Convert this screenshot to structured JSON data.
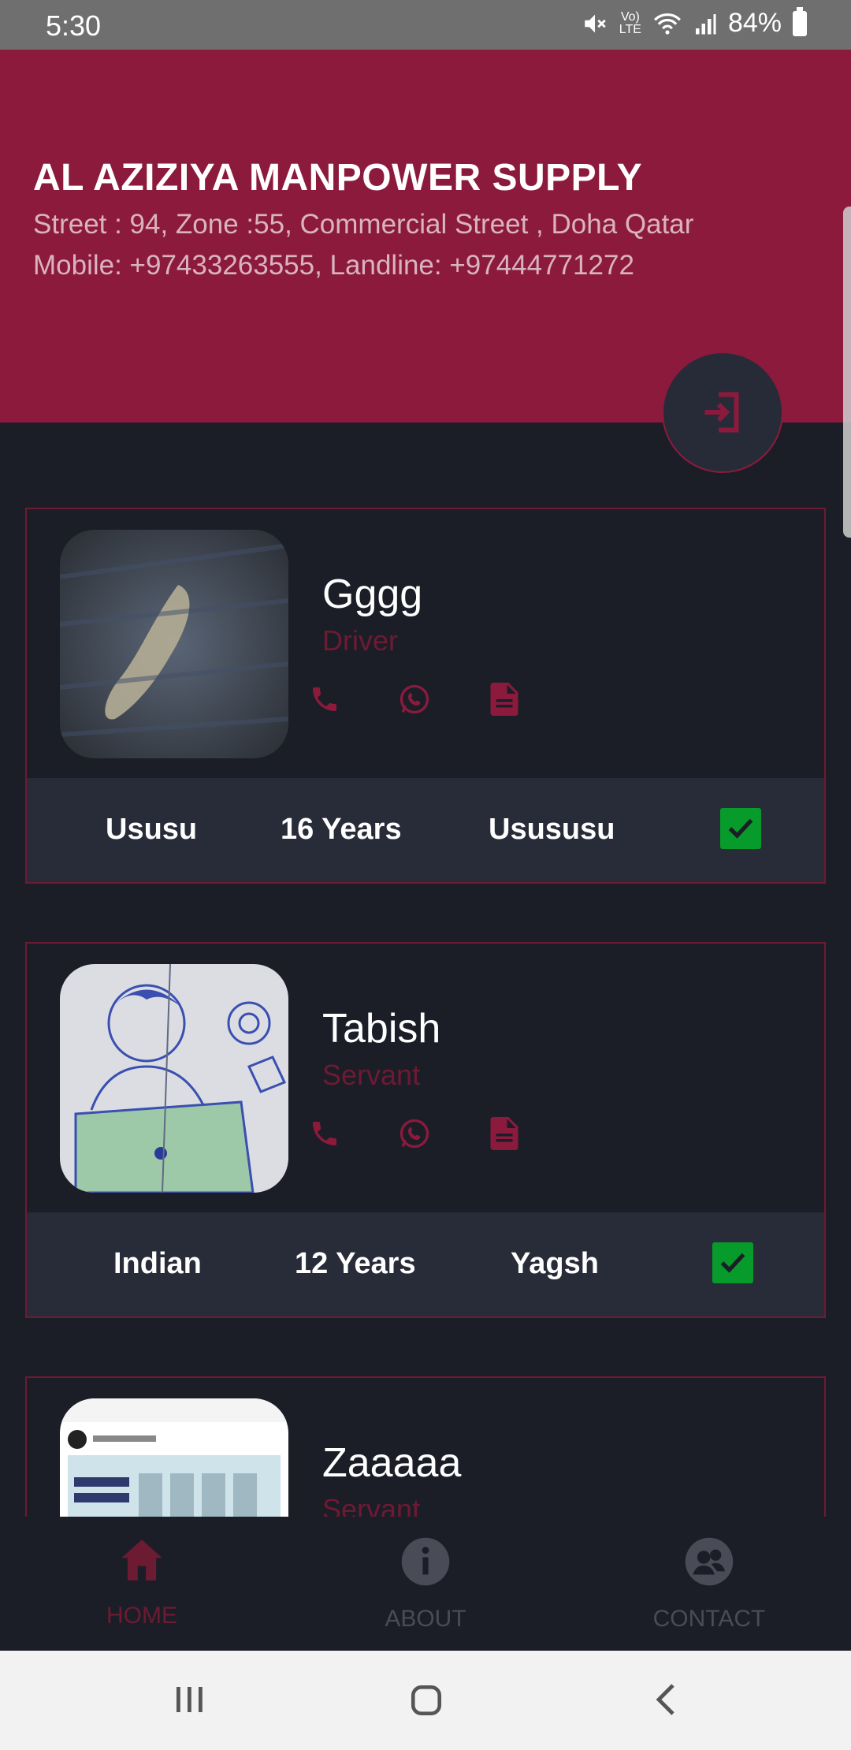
{
  "status_bar": {
    "time": "5:30",
    "battery": "84%",
    "icons": [
      "mute-icon",
      "volte-icon",
      "wifi-icon",
      "signal-icon",
      "battery-icon"
    ]
  },
  "header": {
    "company": "AL AZIZIYA MANPOWER SUPPLY",
    "address": "Street : 94, Zone :55, Commercial Street , Doha Qatar",
    "phones": "Mobile: +97433263555, Landline: +97444771272"
  },
  "fab": {
    "icon": "login-icon"
  },
  "workers": [
    {
      "name": "Gggg",
      "role": "Driver",
      "nationality": "Ususu",
      "experience": "16 Years",
      "extra": "Usususu",
      "verified": true
    },
    {
      "name": "Tabish",
      "role": "Servant",
      "nationality": "Indian",
      "experience": "12 Years",
      "extra": "Yagsh",
      "verified": true
    },
    {
      "name": "Zaaaaa",
      "role": "Servant",
      "nationality": "",
      "experience": "",
      "extra": "",
      "verified": false
    }
  ],
  "bottom_nav": [
    {
      "label": "HOME",
      "icon": "home-icon",
      "active": true
    },
    {
      "label": "ABOUT",
      "icon": "info-icon",
      "active": false
    },
    {
      "label": "CONTACT",
      "icon": "contacts-icon",
      "active": false
    }
  ],
  "colors": {
    "primary": "#8c1a3d",
    "background": "#1b1e27",
    "card_footer": "#282c39",
    "check": "#079b2b"
  }
}
